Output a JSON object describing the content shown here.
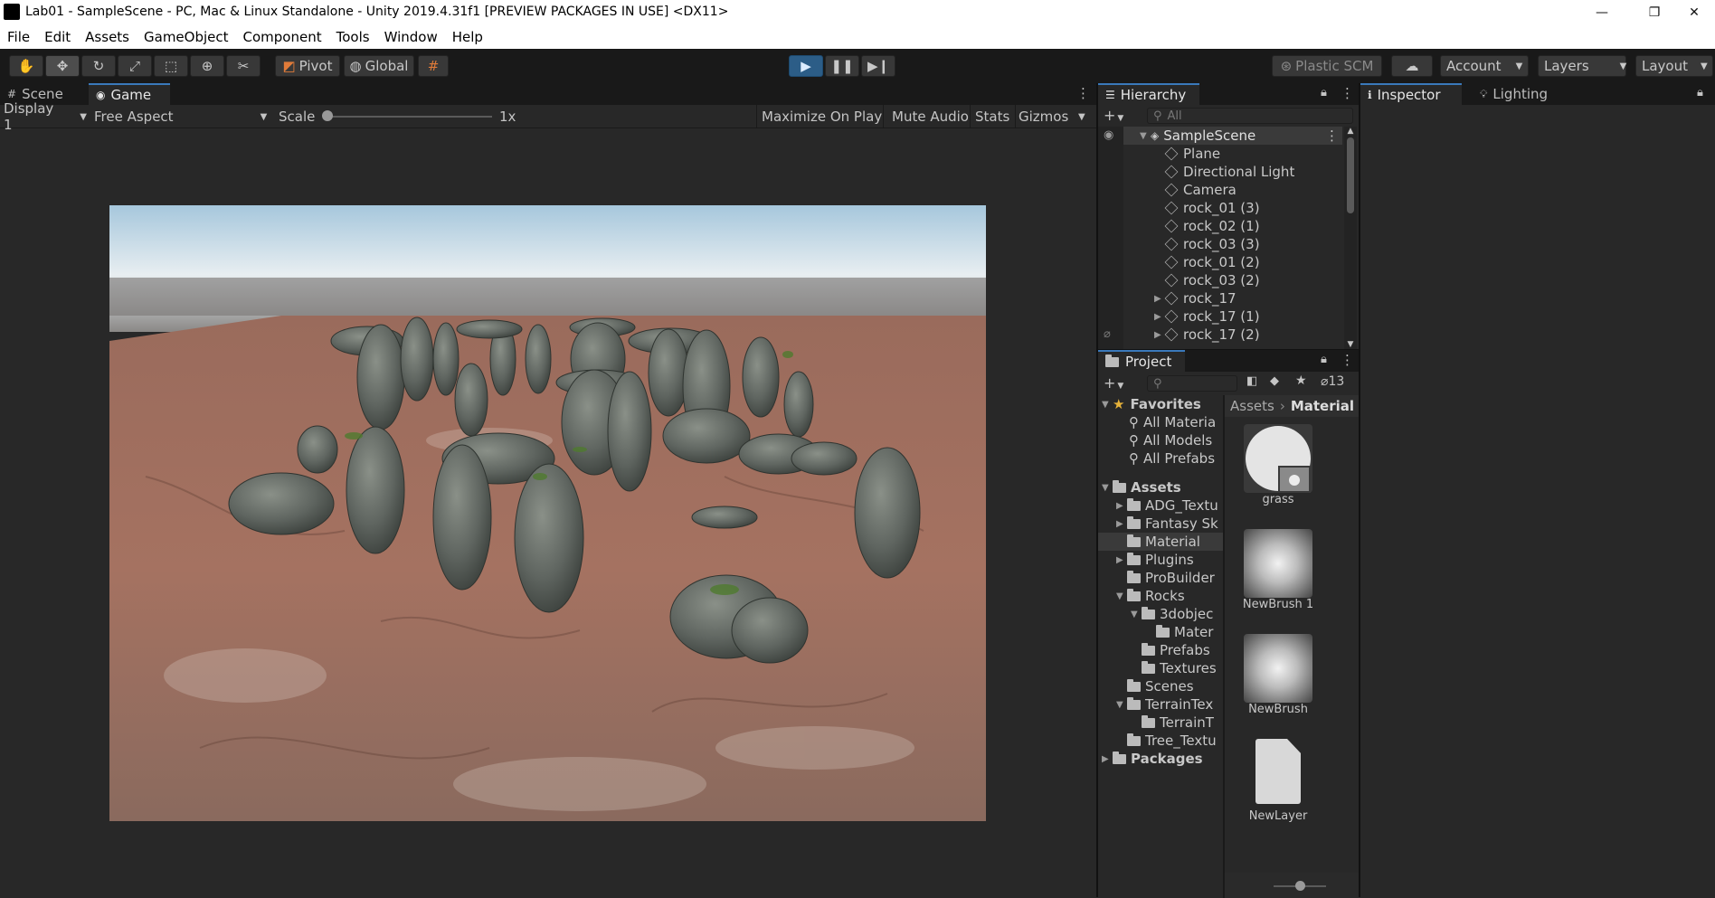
{
  "window": {
    "title": "Lab01 - SampleScene - PC, Mac & Linux Standalone - Unity 2019.4.31f1 [PREVIEW PACKAGES IN USE] <DX11>",
    "minimize": "—",
    "maximize": "❐",
    "close": "✕"
  },
  "menu": [
    "File",
    "Edit",
    "Assets",
    "GameObject",
    "Component",
    "Tools",
    "Window",
    "Help"
  ],
  "toolbar": {
    "pivot": "Pivot",
    "global": "Global",
    "plastic": "Plastic SCM",
    "account": "Account",
    "layers": "Layers",
    "layout": "Layout"
  },
  "game_panel": {
    "tabs": [
      "Scene",
      "Game"
    ],
    "display": "Display 1",
    "aspect": "Free Aspect",
    "scale_label": "Scale",
    "scale_value": "1x",
    "maximize": "Maximize On Play",
    "mute": "Mute Audio",
    "stats": "Stats",
    "gizmos": "Gizmos"
  },
  "hierarchy": {
    "tab": "Hierarchy",
    "search_placeholder": "All",
    "scene": "SampleScene",
    "items": [
      {
        "name": "Plane",
        "expandable": false
      },
      {
        "name": "Directional Light",
        "expandable": false
      },
      {
        "name": "Camera",
        "expandable": false
      },
      {
        "name": "rock_01 (3)",
        "expandable": false
      },
      {
        "name": "rock_02 (1)",
        "expandable": false
      },
      {
        "name": "rock_03 (3)",
        "expandable": false
      },
      {
        "name": "rock_01 (2)",
        "expandable": false
      },
      {
        "name": "rock_03 (2)",
        "expandable": false
      },
      {
        "name": "rock_17",
        "expandable": true
      },
      {
        "name": "rock_17 (1)",
        "expandable": true
      },
      {
        "name": "rock_17 (2)",
        "expandable": true
      }
    ]
  },
  "inspector": {
    "tabs": [
      "Inspector",
      "Lighting"
    ]
  },
  "project": {
    "tab": "Project",
    "hidden_count": "13",
    "favorites_label": "Favorites",
    "favorites": [
      "All Materia",
      "All Models",
      "All Prefabs"
    ],
    "assets_label": "Assets",
    "tree": [
      {
        "name": "ADG_Textu",
        "indent": 1,
        "arrow": "▶"
      },
      {
        "name": "Fantasy Sk",
        "indent": 1,
        "arrow": "▶"
      },
      {
        "name": "Material",
        "indent": 1,
        "arrow": "",
        "selected": true
      },
      {
        "name": "Plugins",
        "indent": 1,
        "arrow": "▶"
      },
      {
        "name": "ProBuilder",
        "indent": 1,
        "arrow": ""
      },
      {
        "name": "Rocks",
        "indent": 1,
        "arrow": "▼"
      },
      {
        "name": "3dobjec",
        "indent": 2,
        "arrow": "▼"
      },
      {
        "name": "Mater",
        "indent": 3,
        "arrow": ""
      },
      {
        "name": "Prefabs",
        "indent": 2,
        "arrow": ""
      },
      {
        "name": "Textures",
        "indent": 2,
        "arrow": ""
      },
      {
        "name": "Scenes",
        "indent": 1,
        "arrow": ""
      },
      {
        "name": "TerrainTex",
        "indent": 1,
        "arrow": "▼"
      },
      {
        "name": "TerrainT",
        "indent": 2,
        "arrow": ""
      },
      {
        "name": "Tree_Textu",
        "indent": 1,
        "arrow": ""
      }
    ],
    "packages_label": "Packages",
    "breadcrumb": [
      "Assets",
      "Material"
    ],
    "assets": [
      "grass",
      "NewBrush 1",
      "NewBrush",
      "NewLayer"
    ]
  },
  "colors": {
    "accent": "#3a79bb",
    "play_active": "#2c5d87",
    "panel": "#282828",
    "toolbar": "#191919"
  }
}
